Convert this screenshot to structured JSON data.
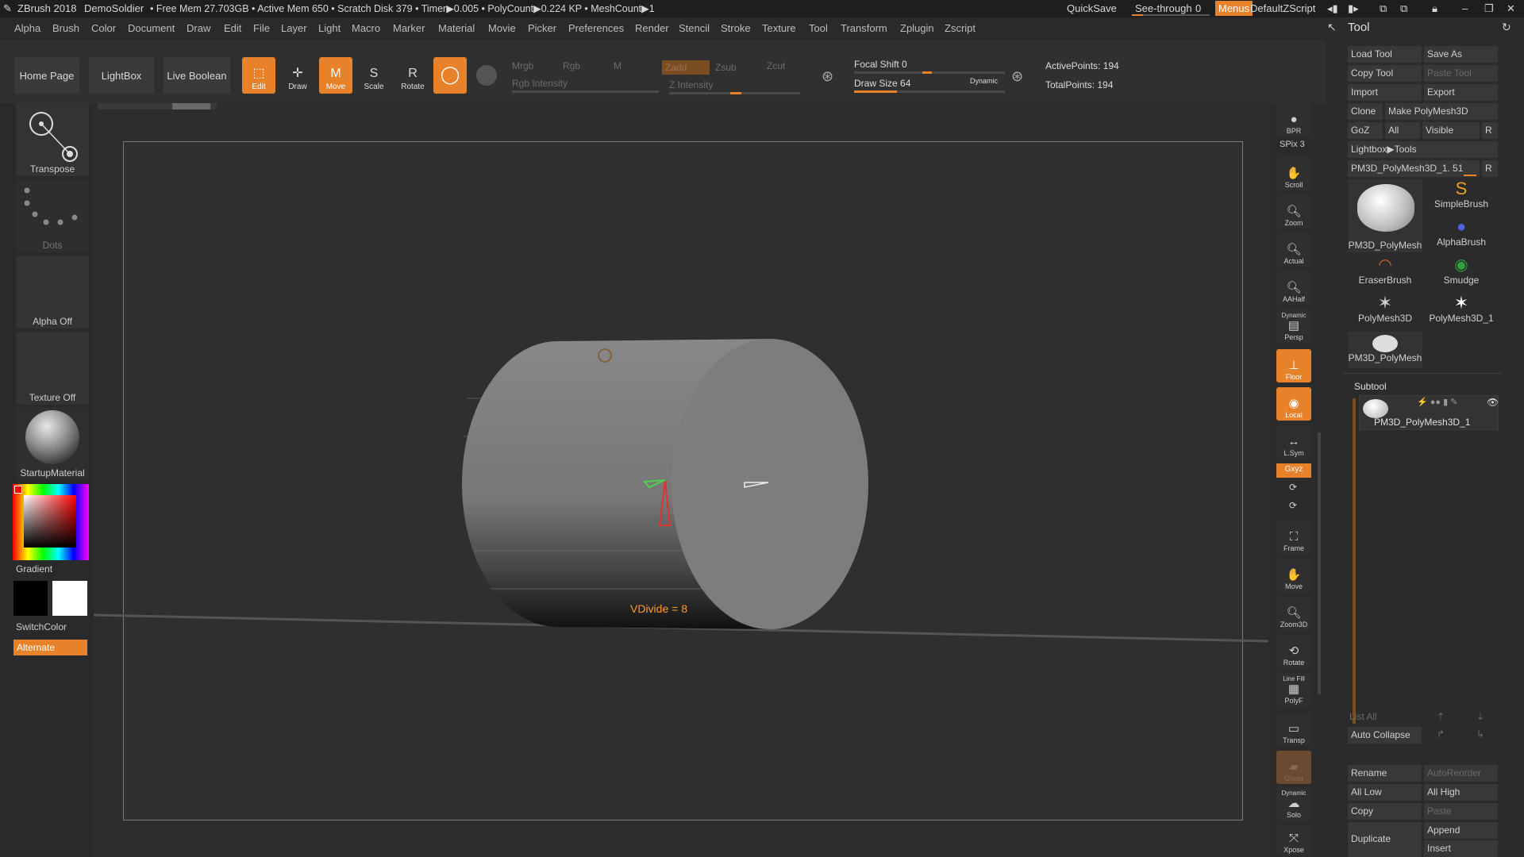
{
  "titlebar": {
    "app": "ZBrush 2018",
    "project": "DemoSoldier",
    "stats": "• Free Mem 27.703GB • Active Mem 650 • Scratch Disk 379 • Timer▶0.005 • PolyCount▶0.224 KP • MeshCount▶1",
    "quicksave": "QuickSave",
    "see_through": "See-through",
    "see_through_value": "0",
    "menus": "Menus",
    "script": "DefaultZScript"
  },
  "menubar": [
    "Alpha",
    "Brush",
    "Color",
    "Document",
    "Draw",
    "Edit",
    "File",
    "Layer",
    "Light",
    "Macro",
    "Marker",
    "Material",
    "Movie",
    "Picker",
    "Preferences",
    "Render",
    "Stencil",
    "Stroke",
    "Texture",
    "Tool",
    "Transform",
    "Zplugin",
    "Zscript"
  ],
  "shelf": {
    "home": "Home Page",
    "lightbox": "LightBox",
    "live_boolean": "Live Boolean",
    "edit": "Edit",
    "draw": "Draw",
    "move": "Move",
    "scale": "Scale",
    "rotate": "Rotate",
    "mrgb": "Mrgb",
    "rgb": "Rgb",
    "m": "M",
    "rgb_intensity": "Rgb Intensity",
    "zadd": "Zadd",
    "zsub": "Zsub",
    "zcut": "Zcut",
    "z_intensity": "Z Intensity",
    "focal_shift_label": "Focal Shift",
    "focal_shift": "0",
    "draw_size_label": "Draw Size",
    "draw_size": "64",
    "dynamic": "Dynamic",
    "active_points": "ActivePoints: 194",
    "total_points": "TotalPoints: 194"
  },
  "left": {
    "transpose": "Transpose",
    "dots": "Dots",
    "alpha": "Alpha Off",
    "texture": "Texture Off",
    "material": "StartupMaterial",
    "gradient": "Gradient",
    "switchcolor": "SwitchColor",
    "alternate": "Alternate"
  },
  "viewport": {
    "vdivide": "VDivide = 8"
  },
  "rightstrip": {
    "bpr": "BPR",
    "spix": "SPix 3",
    "scroll": "Scroll",
    "zoom": "Zoom",
    "actual": "Actual",
    "aahalf": "AAHalf",
    "dynamic": "Dynamic",
    "persp": "Persp",
    "floor": "Floor",
    "local": "Local",
    "lsym": "L.Sym",
    "xyz": "Gxyz",
    "frame": "Frame",
    "move": "Move",
    "zoom3d": "Zoom3D",
    "rotate": "Rotate",
    "linefill": "Line Fill",
    "polyf": "PolyF",
    "transp": "Transp",
    "ghost": "Ghost",
    "solo_dyn": "Dynamic",
    "solo": "Solo",
    "xpose": "Xpose"
  },
  "tool": {
    "title": "Tool",
    "load": "Load Tool",
    "save_as": "Save As",
    "copy": "Copy Tool",
    "paste": "Paste Tool",
    "import": "Import",
    "export": "Export",
    "clone": "Clone",
    "make_polymesh": "Make PolyMesh3D",
    "goz": "GoZ",
    "all": "All",
    "visible": "Visible",
    "r": "R",
    "lightbox_tools": "Lightbox▶Tools",
    "current": "PM3D_PolyMesh3D_1. 51",
    "thumbs": [
      "PM3D_PolyMesh",
      "SimpleBrush",
      "AlphaBrush",
      "EraserBrush",
      "Smudge",
      "PolyMesh3D",
      "PolyMesh3D_1",
      "PM3D_PolyMesh"
    ],
    "subtool": "Subtool",
    "subtool_item": "PM3D_PolyMesh3D_1",
    "list_all": "List All",
    "auto_collapse": "Auto Collapse",
    "rename": "Rename",
    "autoreorder": "AutoReorder",
    "all_low": "All Low",
    "all_high": "All High",
    "copy2": "Copy",
    "paste2": "Paste",
    "duplicate": "Duplicate",
    "append": "Append",
    "insert": "Insert"
  },
  "colors": {
    "accent": "#e7822a"
  }
}
